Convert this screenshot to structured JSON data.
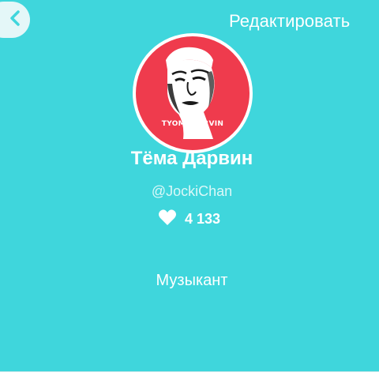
{
  "header": {
    "back_icon": "chevron-left-icon",
    "edit_label": "Редактировать"
  },
  "profile": {
    "avatar_caption": "TYOMADARVIN",
    "avatar_bg": "#ef3b4d",
    "name": "Тёма Дарвин",
    "handle": "@JockiChan",
    "likes_icon": "heart-icon",
    "likes": "4 133",
    "role": "Музыкант"
  },
  "colors": {
    "background": "#3fd6dc",
    "text": "#ffffff"
  }
}
